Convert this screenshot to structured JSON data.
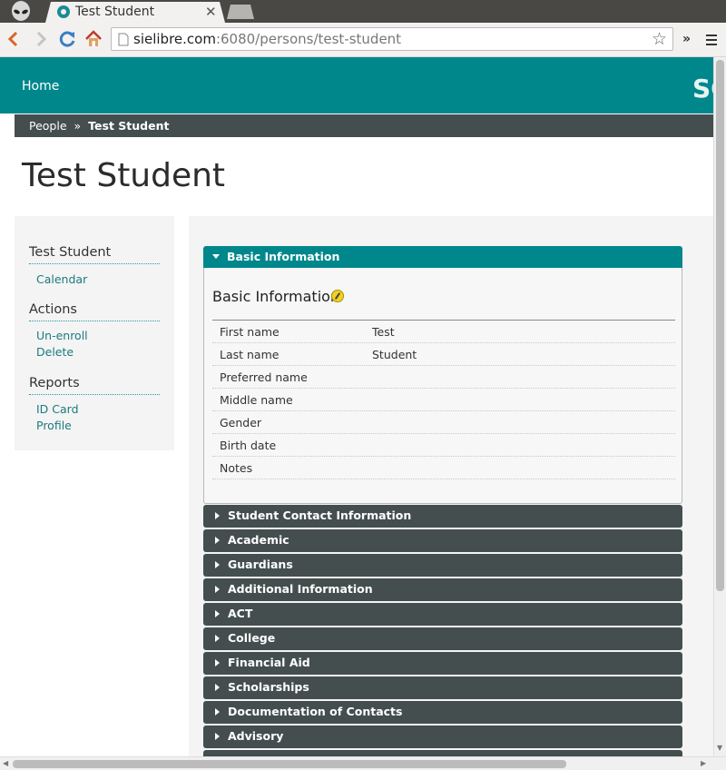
{
  "browser": {
    "tab_title": "Test Student",
    "url_host": "sielibre.com",
    "url_path": ":6080/persons/test-student"
  },
  "header": {
    "home_label": "Home",
    "brand_partial": "SC"
  },
  "breadcrumb": {
    "parent": "People",
    "separator": "»",
    "current": "Test Student"
  },
  "page_title": "Test Student",
  "sidebar": {
    "person_heading": "Test Student",
    "person_links": [
      "Calendar"
    ],
    "actions_heading": "Actions",
    "actions_links": [
      "Un-enroll",
      "Delete"
    ],
    "reports_heading": "Reports",
    "reports_links": [
      "ID Card",
      "Profile"
    ]
  },
  "basic_info": {
    "accordion_label": "Basic Information",
    "section_title": "Basic Information",
    "rows": [
      {
        "label": "First name",
        "value": "Test"
      },
      {
        "label": "Last name",
        "value": "Student"
      },
      {
        "label": "Preferred name",
        "value": ""
      },
      {
        "label": "Middle name",
        "value": ""
      },
      {
        "label": "Gender",
        "value": ""
      },
      {
        "label": "Birth date",
        "value": ""
      },
      {
        "label": "Notes",
        "value": ""
      }
    ]
  },
  "sections": [
    "Student Contact Information",
    "Academic",
    "Guardians",
    "Additional Information",
    "ACT",
    "College",
    "Financial Aid",
    "Scholarships",
    "Documentation of Contacts",
    "Advisory"
  ],
  "colors": {
    "teal": "#00878c",
    "dark_bar": "#444e4e",
    "link": "#1c7a7e"
  }
}
